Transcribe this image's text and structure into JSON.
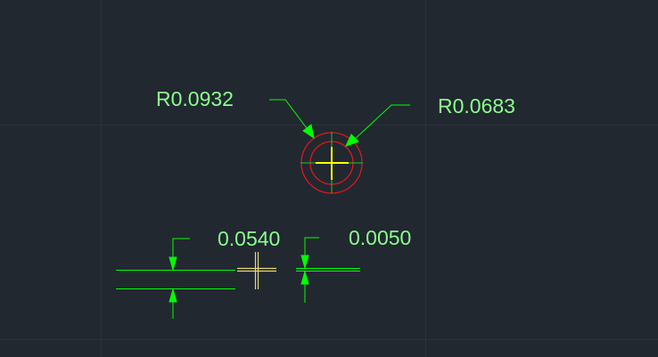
{
  "drawing": {
    "annotations": {
      "radius_large": "R0.0932",
      "radius_small": "R0.0683",
      "linear_left": "0.0540",
      "linear_right": "0.0050"
    },
    "colors": {
      "background": "#212830",
      "grid": "#2b323b",
      "dimension": "#00ff00",
      "dimension_text": "#8cff8c",
      "circle": "#e01818",
      "crosshair": "#ffff00",
      "cursor": "#e8d870"
    }
  }
}
